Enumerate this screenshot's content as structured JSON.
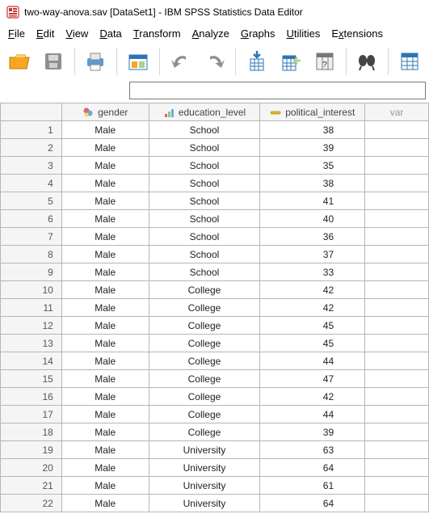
{
  "window": {
    "title": "two-way-anova.sav [DataSet1] - IBM SPSS Statistics Data Editor"
  },
  "menu": {
    "file": "File",
    "edit": "Edit",
    "view": "View",
    "data": "Data",
    "transform": "Transform",
    "analyze": "Analyze",
    "graphs": "Graphs",
    "utilities": "Utilities",
    "extensions": "Extensions"
  },
  "columns": {
    "gender": "gender",
    "education_level": "education_level",
    "political_interest": "political_interest",
    "var": "var"
  },
  "rows": [
    {
      "n": "1",
      "gender": "Male",
      "edu": "School",
      "pol": "38"
    },
    {
      "n": "2",
      "gender": "Male",
      "edu": "School",
      "pol": "39"
    },
    {
      "n": "3",
      "gender": "Male",
      "edu": "School",
      "pol": "35"
    },
    {
      "n": "4",
      "gender": "Male",
      "edu": "School",
      "pol": "38"
    },
    {
      "n": "5",
      "gender": "Male",
      "edu": "School",
      "pol": "41"
    },
    {
      "n": "6",
      "gender": "Male",
      "edu": "School",
      "pol": "40"
    },
    {
      "n": "7",
      "gender": "Male",
      "edu": "School",
      "pol": "36"
    },
    {
      "n": "8",
      "gender": "Male",
      "edu": "School",
      "pol": "37"
    },
    {
      "n": "9",
      "gender": "Male",
      "edu": "School",
      "pol": "33"
    },
    {
      "n": "10",
      "gender": "Male",
      "edu": "College",
      "pol": "42"
    },
    {
      "n": "11",
      "gender": "Male",
      "edu": "College",
      "pol": "42"
    },
    {
      "n": "12",
      "gender": "Male",
      "edu": "College",
      "pol": "45"
    },
    {
      "n": "13",
      "gender": "Male",
      "edu": "College",
      "pol": "45"
    },
    {
      "n": "14",
      "gender": "Male",
      "edu": "College",
      "pol": "44"
    },
    {
      "n": "15",
      "gender": "Male",
      "edu": "College",
      "pol": "47"
    },
    {
      "n": "16",
      "gender": "Male",
      "edu": "College",
      "pol": "42"
    },
    {
      "n": "17",
      "gender": "Male",
      "edu": "College",
      "pol": "44"
    },
    {
      "n": "18",
      "gender": "Male",
      "edu": "College",
      "pol": "39"
    },
    {
      "n": "19",
      "gender": "Male",
      "edu": "University",
      "pol": "63"
    },
    {
      "n": "20",
      "gender": "Male",
      "edu": "University",
      "pol": "64"
    },
    {
      "n": "21",
      "gender": "Male",
      "edu": "University",
      "pol": "61"
    },
    {
      "n": "22",
      "gender": "Male",
      "edu": "University",
      "pol": "64"
    }
  ]
}
